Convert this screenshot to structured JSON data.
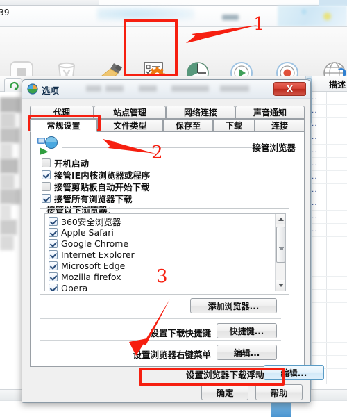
{
  "background": {
    "partial_number": "39",
    "column_header_desc": "描述",
    "row_ellipsis": "...",
    "toolbar": {
      "items": [
        {
          "label": "全部停止",
          "icon": "stop-all-icon",
          "disabled": true,
          "dropdown": false
        },
        {
          "label": "删除任务",
          "icon": "delete-task-trash-icon",
          "disabled": true,
          "dropdown": false
        },
        {
          "label": "删除全部",
          "icon": "delete-all-brush-icon",
          "disabled": false,
          "dropdown": false
        },
        {
          "label": "选项",
          "icon": "options-checklist-gear-icon",
          "disabled": false,
          "dropdown": false
        },
        {
          "label": "计划任务",
          "icon": "scheduled-task-clock-icon",
          "disabled": false,
          "dropdown": false
        },
        {
          "label": "开始队列",
          "icon": "start-queue-play-icon",
          "disabled": false,
          "dropdown": true
        },
        {
          "label": "停止队列",
          "icon": "stop-queue-record-icon",
          "disabled": false,
          "dropdown": true
        },
        {
          "label": "站点抓",
          "icon": "site-grabber-globe-icon",
          "disabled": false,
          "dropdown": false
        }
      ]
    }
  },
  "dialog": {
    "title": "选项",
    "title_icon": "options-globe-icon",
    "close_label": "X",
    "tabs_row1": [
      {
        "label": "代理",
        "active": false
      },
      {
        "label": "站点管理",
        "active": false
      },
      {
        "label": "网络连接",
        "active": false
      },
      {
        "label": "声音通知",
        "active": false
      }
    ],
    "tabs_row2": [
      {
        "label": "常规设置",
        "active": true
      },
      {
        "label": "文件类型",
        "active": false
      },
      {
        "label": "保存至",
        "active": false
      },
      {
        "label": "下载",
        "active": false
      },
      {
        "label": "连接",
        "active": false
      }
    ],
    "panel": {
      "logo_icon": "browser-takeover-icon",
      "section_title": "接管浏览器",
      "checkboxes": [
        {
          "label": "开机启动",
          "checked": false
        },
        {
          "label": "接管IE内核浏览器或程序",
          "checked": true
        },
        {
          "label": "接管剪贴板自动开始下载",
          "checked": false
        },
        {
          "label": "接管所有浏览器下载",
          "checked": true
        }
      ],
      "group_legend": "接管以下浏览器：",
      "browser_list": [
        {
          "label": "360安全浏览器",
          "checked": true
        },
        {
          "label": "Apple Safari",
          "checked": true
        },
        {
          "label": "Google Chrome",
          "checked": true
        },
        {
          "label": "Internet Explorer",
          "checked": true
        },
        {
          "label": "Microsoft Edge",
          "checked": true
        },
        {
          "label": "Mozilla firefox",
          "checked": true
        },
        {
          "label": "Opera",
          "checked": true
        }
      ],
      "add_browser_button": "添加浏览器...",
      "rows": [
        {
          "label": "设置下载快捷键",
          "button": "快捷键...",
          "focused": false
        },
        {
          "label": "设置浏览器右键菜单",
          "button": "编辑...",
          "focused": false
        },
        {
          "label": "设置浏览器下载浮动条",
          "button": "编辑...",
          "focused": true
        }
      ]
    },
    "footer": {
      "ok_label": "确定",
      "help_label": "帮助"
    }
  },
  "annotations": {
    "accent_color": "#f61f10",
    "markers": [
      {
        "number": "1",
        "target": "选项 toolbar button"
      },
      {
        "number": "2",
        "target": "常规设置 tab"
      },
      {
        "number": "3",
        "target": "设置浏览器下载浮动条 编辑... button"
      }
    ]
  }
}
